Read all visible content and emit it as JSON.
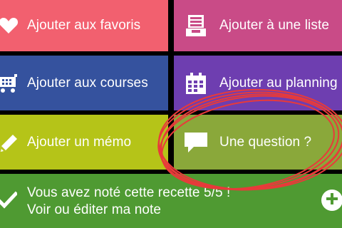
{
  "colors": {
    "favorites": "#f2606f",
    "list": "#c94b87",
    "shopping": "#35529e",
    "planning": "#6e3eb0",
    "memo": "#b5c418",
    "question": "#8aa83a",
    "note": "#4f9a32",
    "annotation": "#e83a3a"
  },
  "tiles": {
    "favorites": {
      "label": "Ajouter aux favoris",
      "icon": "heart-icon"
    },
    "list": {
      "label": "Ajouter à une liste",
      "icon": "list-tray-icon"
    },
    "shopping": {
      "label": "Ajouter aux courses",
      "icon": "shopping-cart-icon"
    },
    "planning": {
      "label": "Ajouter au planning",
      "icon": "calendar-icon"
    },
    "memo": {
      "label": "Ajouter un mémo",
      "icon": "pencil-icon"
    },
    "question": {
      "label": "Une question ?",
      "icon": "speech-bubble-icon"
    }
  },
  "rating": {
    "line1": "Vous avez noté cette recette 5/5 !",
    "line2": "Voir ou éditer ma note",
    "icon": "checkmark-icon",
    "action_icon": "plus-icon"
  }
}
